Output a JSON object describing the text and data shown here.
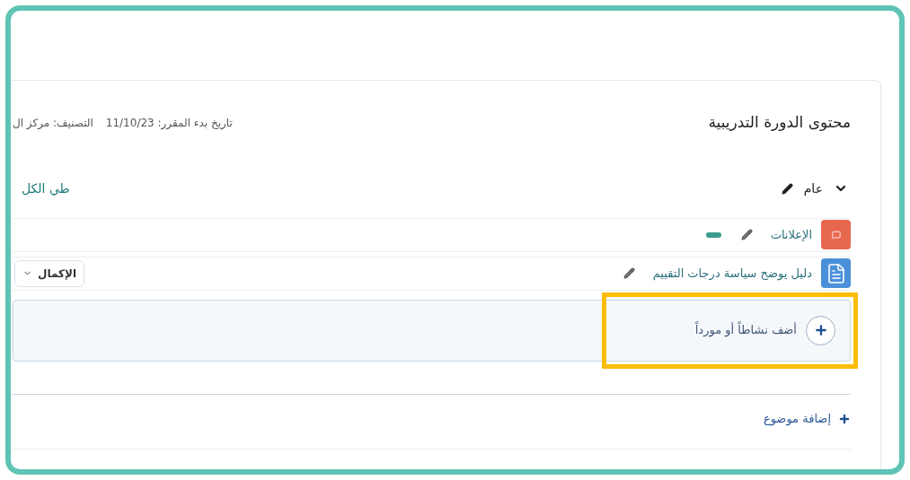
{
  "page": {
    "title": "محتوى الدورة التدريبية",
    "meta": [
      "تاريخ بدء المقرر: 11/10/23",
      "التصنيف: مركز ال"
    ]
  },
  "collapse_all": "طي الكل",
  "section": {
    "title": "عام",
    "expanded": true,
    "activities": [
      {
        "kind": "forum",
        "title": "الإعلانات",
        "indicator": true
      },
      {
        "kind": "file",
        "title": "دليل يوضح سياسة درجات التقييم",
        "completion": "الإكمال"
      }
    ],
    "add_activity": {
      "label": "أضف نشاطاً أو مورداً",
      "highlighted": true
    }
  },
  "add_section": "إضافة موضوع"
}
